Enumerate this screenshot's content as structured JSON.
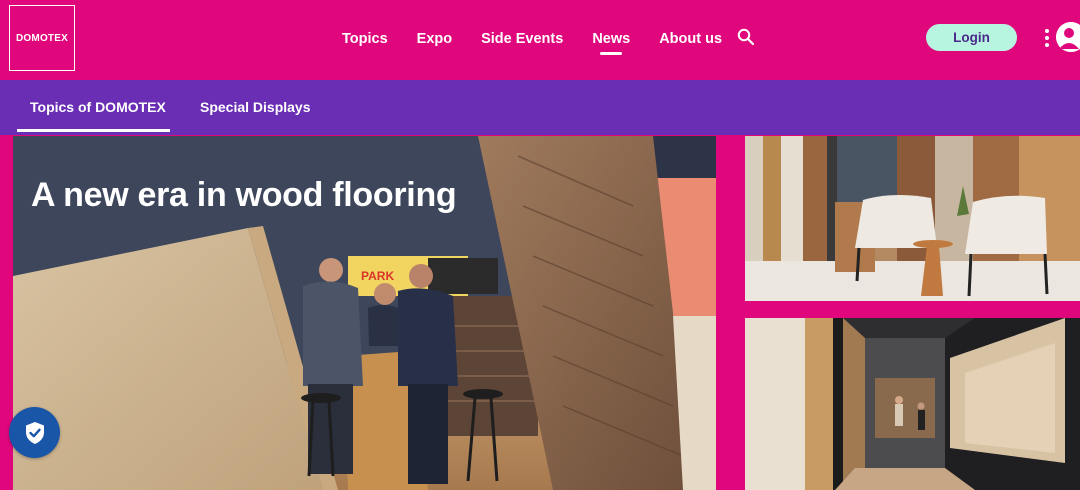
{
  "brand": {
    "logo_text": "DOMOTEX"
  },
  "header": {
    "nav": [
      {
        "label": "Topics",
        "active": false
      },
      {
        "label": "Expo",
        "active": false
      },
      {
        "label": "Side Events",
        "active": false
      },
      {
        "label": "News",
        "active": true
      },
      {
        "label": "About us",
        "active": false
      }
    ],
    "login_label": "Login",
    "icons": [
      "search-icon",
      "kebab-menu-icon",
      "user-icon"
    ]
  },
  "subnav": {
    "items": [
      {
        "label": "Topics of DOMOTEX",
        "active": true
      },
      {
        "label": "Special Displays",
        "active": false
      }
    ]
  },
  "hero": {
    "headline": "A new era in wood flooring",
    "sign_text": "PARK"
  },
  "colors": {
    "brand_magenta": "#e0077d",
    "subnav_purple": "#6a2eb4",
    "login_bg": "#b7f5e1",
    "shield_blue": "#1a56a8"
  },
  "consent": {
    "icon": "shield-check-icon"
  }
}
